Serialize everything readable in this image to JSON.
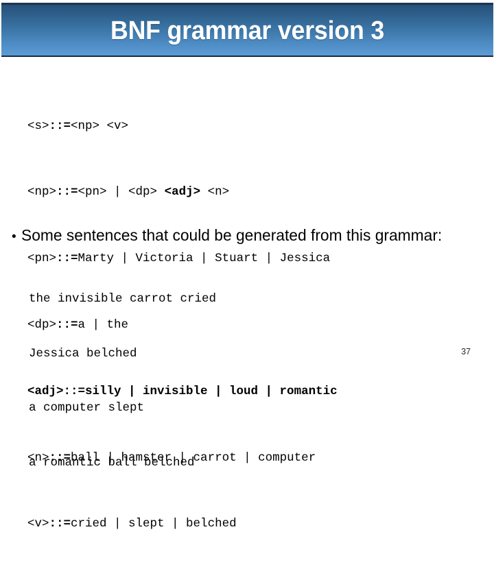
{
  "slide": {
    "title": "BNF grammar version 3",
    "page_number": "37",
    "accent_color": "#3b75a6",
    "title_gradient_top": "#1d3c5c",
    "title_gradient_bottom": "#5b9bd5",
    "text_color": "#000000",
    "background_color": "#ffffff"
  },
  "grammar": {
    "lines": [
      {
        "lhs": "<s>",
        "op": "::=",
        "rhs": "<np> <v>",
        "rhs_bold": false,
        "line_bold": false
      },
      {
        "lhs": "<np>",
        "op": "::=",
        "rhs_pre": "<pn> | <dp> ",
        "rhs_bold_part": "<adj>",
        "rhs_post": " <n>",
        "line_bold": false
      },
      {
        "lhs": "<pn>",
        "op": "::=",
        "rhs": "Marty | Victoria | Stuart | Jessica",
        "rhs_bold": false,
        "line_bold": false
      },
      {
        "lhs": "<dp>",
        "op": "::=",
        "rhs": "a | the",
        "rhs_bold": false,
        "line_bold": false
      },
      {
        "lhs": "<adj>",
        "op": "::=",
        "rhs": "silly | invisible | loud | romantic",
        "rhs_bold": true,
        "line_bold": true
      },
      {
        "lhs": "<n>",
        "op": "::=",
        "rhs": "ball | hamster | carrot | computer",
        "rhs_bold": false,
        "line_bold": false
      },
      {
        "lhs": "<v>",
        "op": "::=",
        "rhs": "cried | slept | belched",
        "rhs_bold": false,
        "line_bold": false
      }
    ],
    "text": {
      "line1": "<s>::=<np> <v>",
      "line2_pre": "<np>",
      "line2_op": "::=",
      "line2_mid": "<pn> | <dp> ",
      "line2_bold": "<adj>",
      "line2_post": " <n>",
      "line3_pre": "<pn>",
      "line3_op": "::=",
      "line3_post": "Marty | Victoria | Stuart | Jessica",
      "line4_pre": "<dp>",
      "line4_op": "::=",
      "line4_post": "a | the",
      "line5": "<adj>::=silly | invisible | loud | romantic",
      "line6_pre": "<n>",
      "line6_op": "::=",
      "line6_post": "ball | hamster | carrot | computer",
      "line7_pre": "<v>",
      "line7_op": "::=",
      "line7_post": "cried | slept | belched",
      "line1_pre": "<s>",
      "line1_op": "::=",
      "line1_post": "<np> <v>"
    }
  },
  "bullet": {
    "marker": "•",
    "text": "Some sentences that could be generated from this grammar:"
  },
  "examples": {
    "sentences": [
      "the invisible carrot cried",
      "Jessica belched",
      "a computer slept",
      "a romantic ball belched"
    ],
    "s0": "the invisible carrot cried",
    "s1": "Jessica belched",
    "s2": "a computer slept",
    "s3": "a romantic ball belched"
  }
}
